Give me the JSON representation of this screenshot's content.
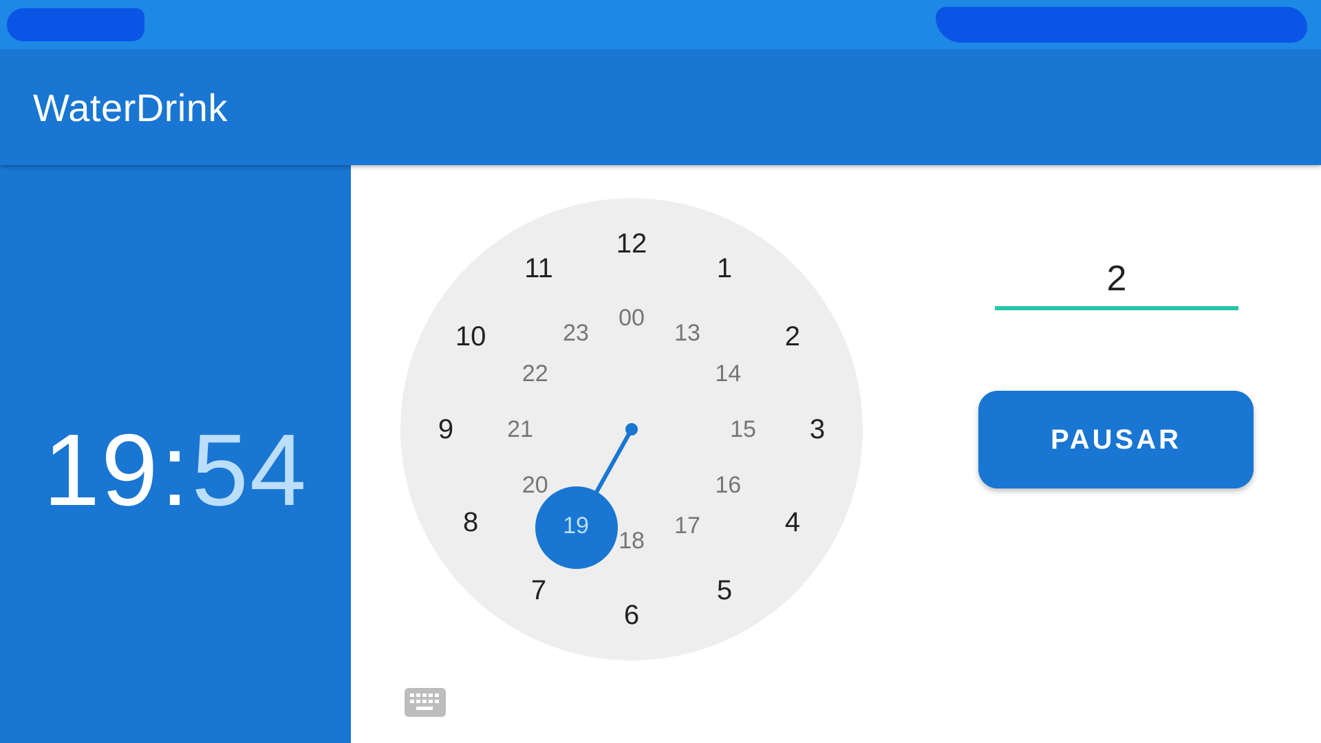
{
  "app": {
    "title": "WaterDrink",
    "primary_color": "#1976d2",
    "status_bar_color": "#1e88e5",
    "accent_color": "#26c6aa"
  },
  "time_display": {
    "hours": "19",
    "separator": ":",
    "minutes": "54"
  },
  "clock": {
    "outer_hours": [
      "12",
      "1",
      "2",
      "3",
      "4",
      "5",
      "6",
      "7",
      "8",
      "9",
      "10",
      "11"
    ],
    "inner_hours": [
      "00",
      "13",
      "14",
      "15",
      "16",
      "17",
      "18",
      "19",
      "20",
      "21",
      "22",
      "23"
    ],
    "selected_hour": "19",
    "mode_toggle_icon": "keyboard-icon"
  },
  "interval_input": {
    "value": "2"
  },
  "pause_button": {
    "label": "PAUSAR"
  }
}
